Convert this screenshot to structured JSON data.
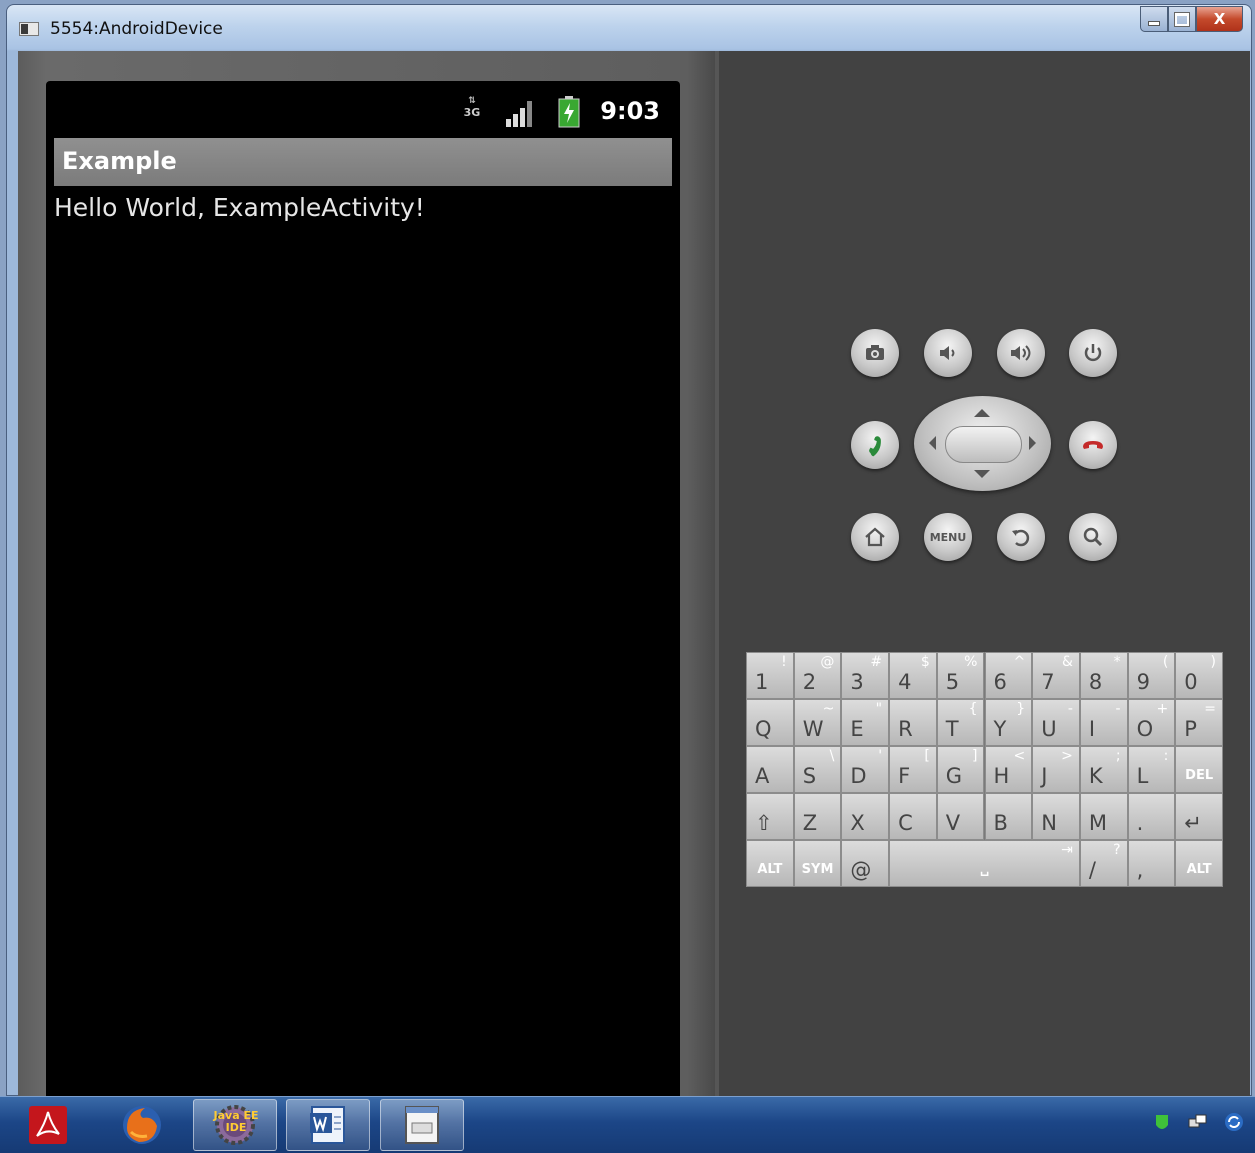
{
  "window": {
    "title": "5554:AndroidDevice",
    "minimize_icon": "minimize-icon",
    "maximize_icon": "maximize-icon",
    "close_icon": "close-icon",
    "close_glyph": "X"
  },
  "phone": {
    "status": {
      "time": "9:03",
      "network": "3G",
      "icons": [
        "3g-data-icon",
        "signal-icon",
        "battery-charging-icon"
      ]
    },
    "app_title": "Example",
    "content_text": "Hello World, ExampleActivity!"
  },
  "controls": {
    "row1": [
      "camera-icon",
      "volume-down-icon",
      "volume-up-icon",
      "power-icon"
    ],
    "row2": [
      "call-icon",
      "dpad",
      "end-call-icon"
    ],
    "row3": [
      "home-icon",
      "menu-button",
      "back-icon",
      "search-icon"
    ],
    "menu_label": "MENU"
  },
  "keyboard": {
    "row1": [
      {
        "k": "1",
        "s": "!"
      },
      {
        "k": "2",
        "s": "@"
      },
      {
        "k": "3",
        "s": "#"
      },
      {
        "k": "4",
        "s": "$"
      },
      {
        "k": "5",
        "s": "%"
      },
      {
        "k": "6",
        "s": "^"
      },
      {
        "k": "7",
        "s": "&"
      },
      {
        "k": "8",
        "s": "*"
      },
      {
        "k": "9",
        "s": "("
      },
      {
        "k": "0",
        "s": ")"
      }
    ],
    "row2": [
      {
        "k": "Q",
        "s": ""
      },
      {
        "k": "W",
        "s": "~"
      },
      {
        "k": "E",
        "s": "\""
      },
      {
        "k": "R",
        "s": ""
      },
      {
        "k": "T",
        "s": "{"
      },
      {
        "k": "Y",
        "s": "}"
      },
      {
        "k": "U",
        "s": "-"
      },
      {
        "k": "I",
        "s": "-"
      },
      {
        "k": "O",
        "s": "+"
      },
      {
        "k": "P",
        "s": "="
      }
    ],
    "row3": [
      {
        "k": "A",
        "s": ""
      },
      {
        "k": "S",
        "s": "\\"
      },
      {
        "k": "D",
        "s": "'"
      },
      {
        "k": "F",
        "s": "["
      },
      {
        "k": "G",
        "s": "]"
      },
      {
        "k": "H",
        "s": "<"
      },
      {
        "k": "J",
        "s": ">"
      },
      {
        "k": "K",
        "s": ";"
      },
      {
        "k": "L",
        "s": ":"
      },
      {
        "k": "DEL",
        "s": ""
      }
    ],
    "row4": [
      {
        "k": "⇧",
        "s": ""
      },
      {
        "k": "Z",
        "s": ""
      },
      {
        "k": "X",
        "s": ""
      },
      {
        "k": "C",
        "s": ""
      },
      {
        "k": "V",
        "s": ""
      },
      {
        "k": "B",
        "s": ""
      },
      {
        "k": "N",
        "s": ""
      },
      {
        "k": "M",
        "s": ""
      },
      {
        "k": ".",
        "s": ""
      },
      {
        "k": "↵",
        "s": ""
      }
    ],
    "row5": {
      "alt_left": "ALT",
      "sym": "SYM",
      "at": "@",
      "space": "␣",
      "tab": "⇥",
      "slash": "/",
      "slash_alt": "?",
      "comma": ",",
      "alt_right": "ALT"
    }
  },
  "taskbar": {
    "items": [
      "adobe-reader-icon",
      "firefox-icon",
      "eclipse-java-ee-icon",
      "word-icon",
      "emulator-window-icon"
    ],
    "eclipse_label": "Java EE IDE",
    "tray": [
      "shield-icon",
      "network-icon",
      "sync-icon"
    ]
  }
}
